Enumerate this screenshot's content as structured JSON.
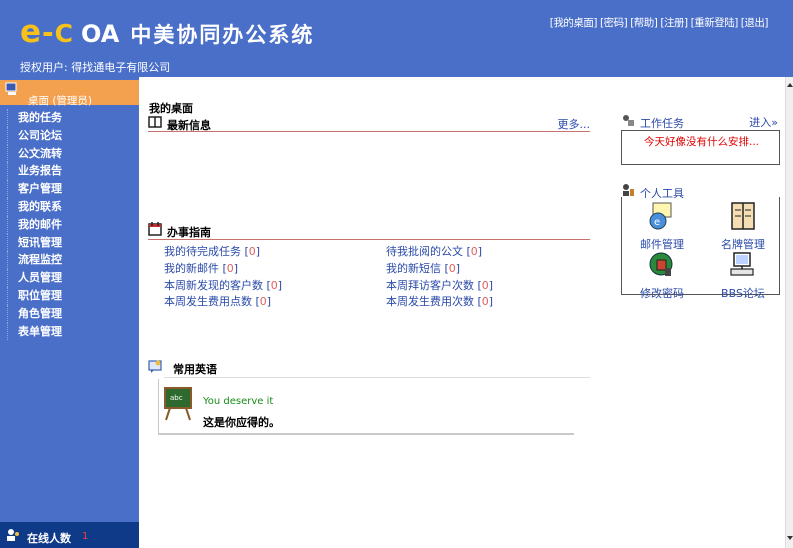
{
  "header": {
    "logo": {
      "e": "e",
      "dash": "-",
      "c": "C",
      "oa": "OA",
      "cn": "中美协同办公系统"
    },
    "authorized": "授权用户: 得找通电子有限公司",
    "links": [
      "[我的桌面]",
      "[密码]",
      "[帮助]",
      "[注册]",
      "[重新登陆]",
      "[退出]"
    ]
  },
  "sidebar": {
    "head": "桌面 (管理员)",
    "items": [
      "我的任务",
      "公司论坛",
      "公文流转",
      "业务报告",
      "客户管理",
      "我的联系",
      "我的邮件",
      "短讯管理",
      "流程监控",
      "人员管理",
      "职位管理",
      "角色管理",
      "表单管理"
    ],
    "online_label": "在线人数",
    "online_count": "1"
  },
  "main": {
    "title": "我的桌面",
    "news": {
      "title": "最新信息",
      "more": "更多..."
    },
    "guide": {
      "title": "办事指南",
      "items": [
        {
          "label": "我的待完成任务",
          "value": "0"
        },
        {
          "label": "待我批阅的公文",
          "value": "0"
        },
        {
          "label": "我的新邮件",
          "value": "0"
        },
        {
          "label": "我的新短信",
          "value": "0"
        },
        {
          "label": "本周新发现的客户数",
          "value": "0"
        },
        {
          "label": "本周拜访客户次数",
          "value": "0"
        },
        {
          "label": "本周发生费用点数",
          "value": "0"
        },
        {
          "label": "本周发生费用次数",
          "value": "0"
        }
      ]
    },
    "english": {
      "title": "常用英语",
      "en": "You deserve it",
      "cn": "这是你应得的。"
    }
  },
  "right": {
    "task": {
      "title": "工作任务",
      "enter": "进入»",
      "empty": "今天好像没有什么安排..."
    },
    "tools": {
      "title": "个人工具",
      "items": [
        "邮件管理",
        "名牌管理",
        "修改密码",
        "BBS论坛"
      ]
    }
  },
  "colors": {
    "header_bg": "#4a6fc9",
    "sidebar_head": "#f3a04f",
    "footer_bg": "#0f3a88",
    "link": "#2a4aa8",
    "rule": "#c8716d"
  }
}
